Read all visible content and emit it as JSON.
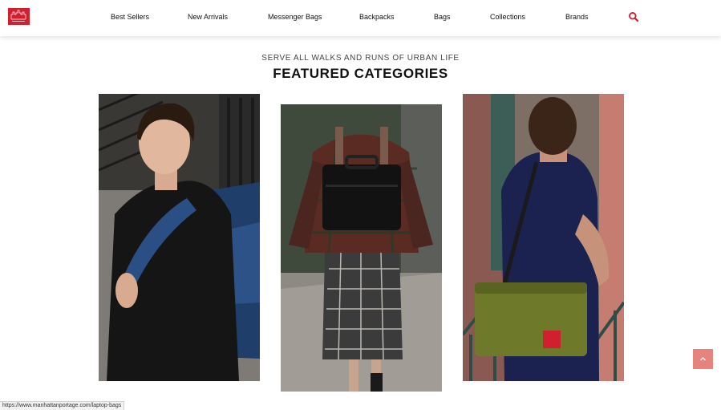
{
  "header": {
    "logo_icon": "manhattan-portage-skyline-logo",
    "brand_color": "#d0202f",
    "nav": [
      {
        "label": "Best Sellers"
      },
      {
        "label": "New Arrivals"
      },
      {
        "label": "Messenger Bags"
      },
      {
        "label": "Backpacks"
      },
      {
        "label": "Bags"
      },
      {
        "label": "Collections"
      },
      {
        "label": "Brands"
      }
    ],
    "search_icon": "search-icon"
  },
  "main": {
    "tagline": "SERVE ALL WALKS AND RUNS OF URBAN LIFE",
    "title": "FEATURED CATEGORIES",
    "categories": [
      {
        "image": "man-with-blue-backpack"
      },
      {
        "image": "woman-in-plaid-with-black-laptop-backpack"
      },
      {
        "image": "man-with-green-messenger-bag"
      }
    ]
  },
  "scroll_top": {
    "icon": "chevron-up-icon",
    "color": "#e7837d"
  },
  "status_bar": {
    "url": "https://www.manhattanportage.com/laptop-bags"
  }
}
